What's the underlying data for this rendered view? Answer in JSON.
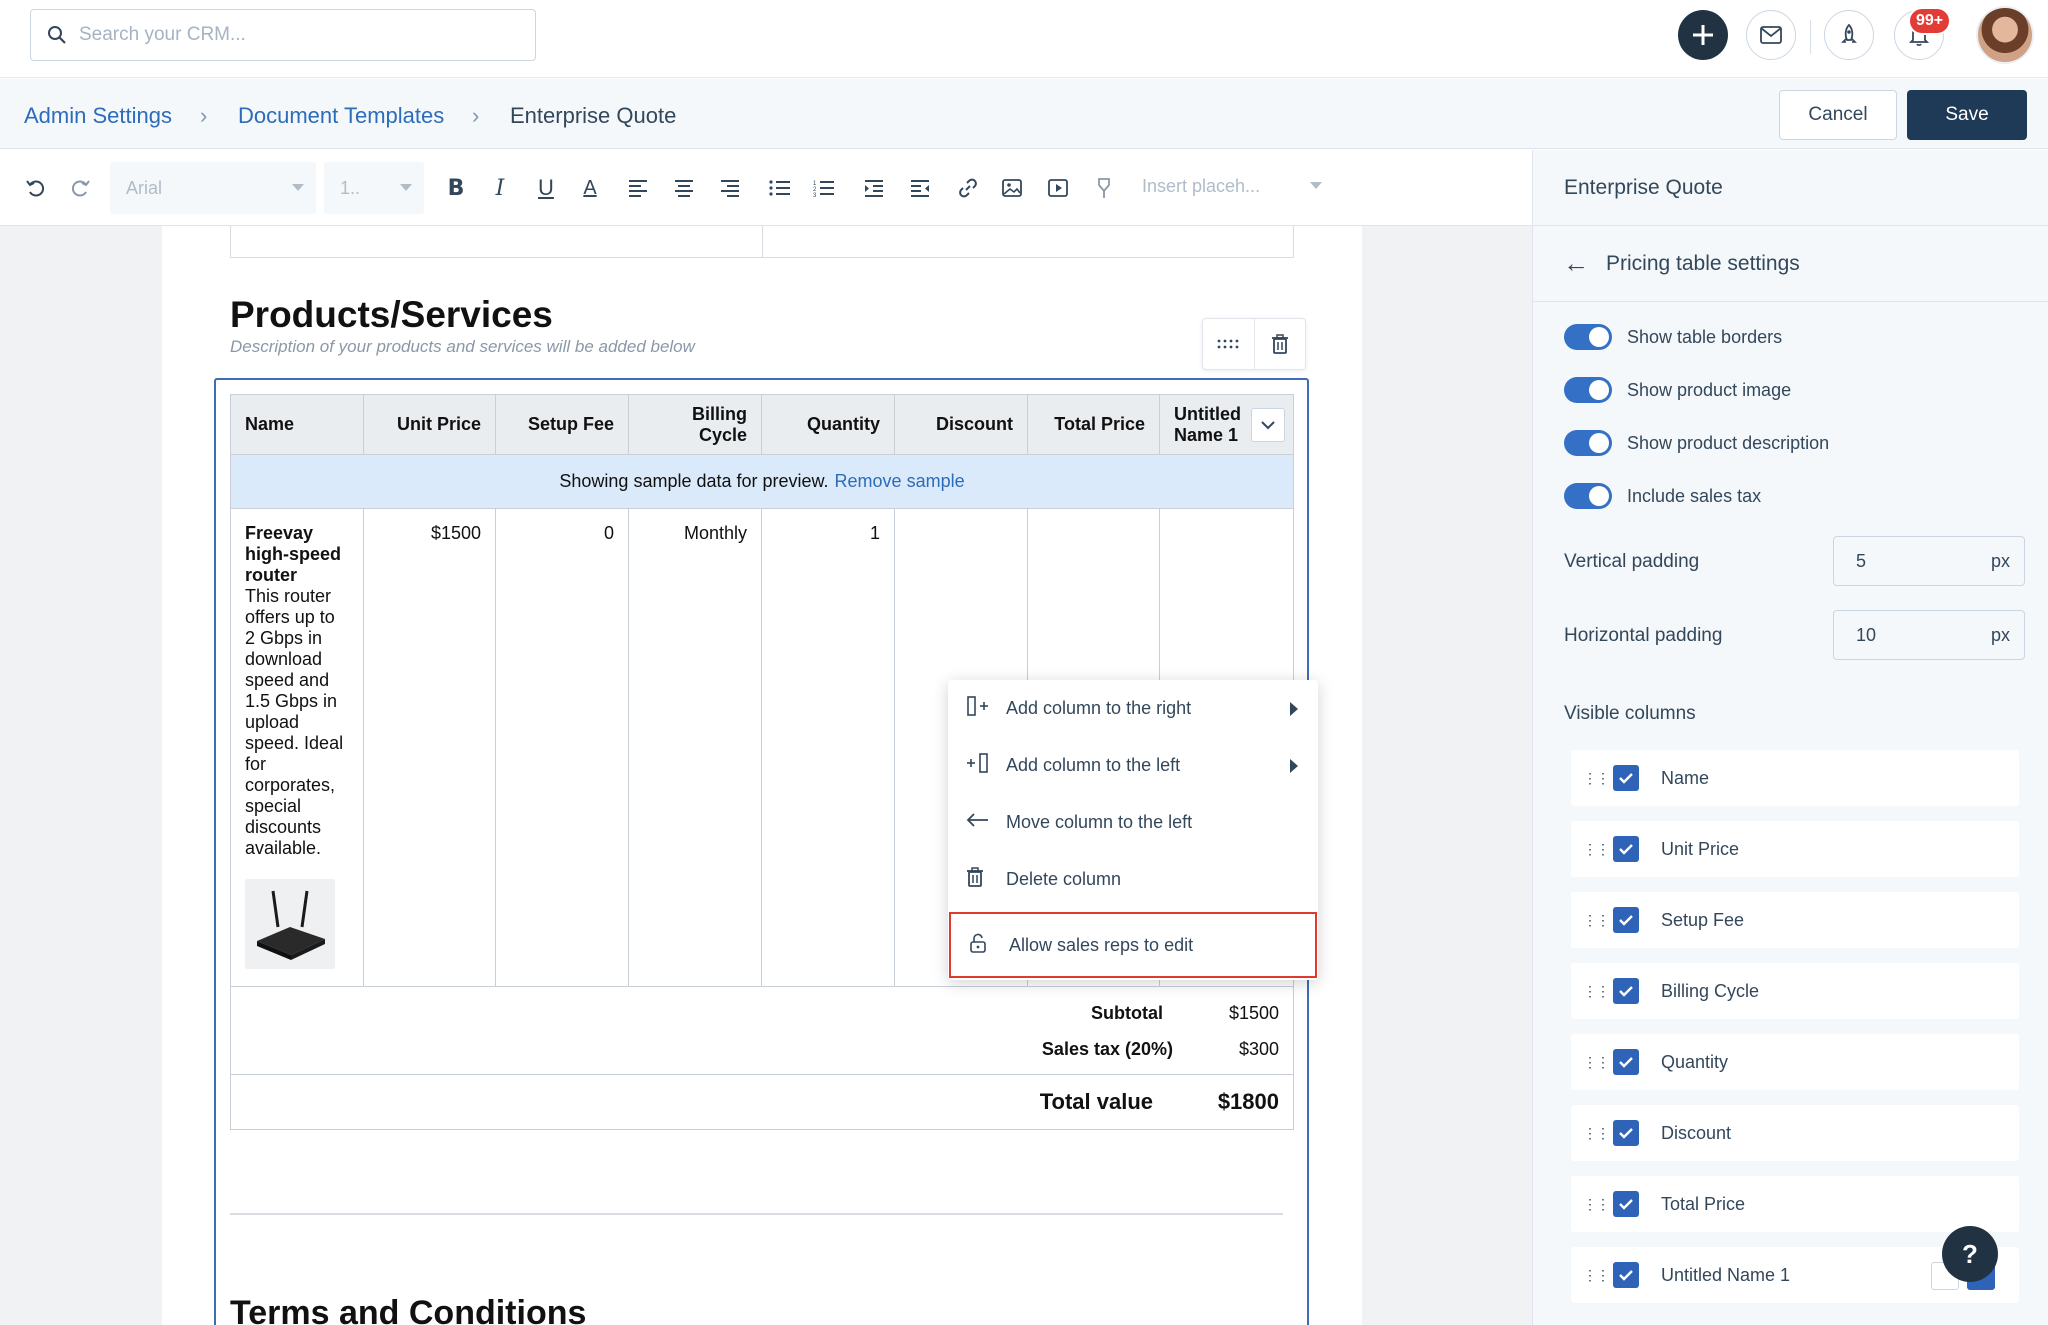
{
  "topbar": {
    "search_placeholder": "Search your CRM...",
    "notification_count": "99+"
  },
  "breadcrumb": {
    "items": [
      "Admin Settings",
      "Document Templates"
    ],
    "current": "Enterprise Quote"
  },
  "actions": {
    "cancel": "Cancel",
    "save": "Save"
  },
  "toolbar": {
    "font": "Arial",
    "size": "1..",
    "insert_placeholder": "Insert placeh..."
  },
  "document": {
    "section_title": "Products/Services",
    "section_desc": "Description of your products and services will be added below",
    "columns": [
      "Name",
      "Unit Price",
      "Setup Fee",
      "Billing Cycle",
      "Quantity",
      "Discount",
      "Total Price",
      "Untitled Name 1"
    ],
    "banner_text": "Showing sample data for preview.",
    "banner_link": "Remove sample",
    "row": {
      "name": "Freevay high-speed router",
      "description": "This router offers up to 2 Gbps in download speed and 1.5 Gbps in upload speed. Ideal for corporates, special discounts available.",
      "unit_price": "$1500",
      "setup_fee": "0",
      "billing_cycle": "Monthly",
      "quantity": "1"
    },
    "subtotal_label": "Subtotal",
    "subtotal_value": "$1500",
    "tax_label": "Sales tax (20%)",
    "tax_value": "$300",
    "total_label": "Total value",
    "total_value": "$1800",
    "next_section": "Terms and Conditions"
  },
  "context_menu": {
    "items": [
      "Add column to the right",
      "Add column to the left",
      "Move column to the left",
      "Delete column",
      "Allow sales reps to edit"
    ],
    "highlighted": "Allow sales reps to edit"
  },
  "panel": {
    "title": "Enterprise Quote",
    "subtitle": "Pricing table settings",
    "toggles": [
      {
        "label": "Show table borders",
        "on": true
      },
      {
        "label": "Show product image",
        "on": true
      },
      {
        "label": "Show product description",
        "on": true
      },
      {
        "label": "Include sales tax",
        "on": true
      }
    ],
    "vertical_padding_label": "Vertical padding",
    "vertical_padding": "5",
    "horizontal_padding_label": "Horizontal padding",
    "horizontal_padding": "10",
    "unit": "px",
    "visible_columns_label": "Visible columns",
    "visible_columns": [
      "Name",
      "Unit Price",
      "Setup Fee",
      "Billing Cycle",
      "Quantity",
      "Discount",
      "Total Price",
      "Untitled Name 1"
    ]
  },
  "help_label": "?",
  "colors": {
    "primary_dark": "#213343",
    "accent_blue": "#2c6cb8",
    "highlight_red": "#e03a2f"
  }
}
